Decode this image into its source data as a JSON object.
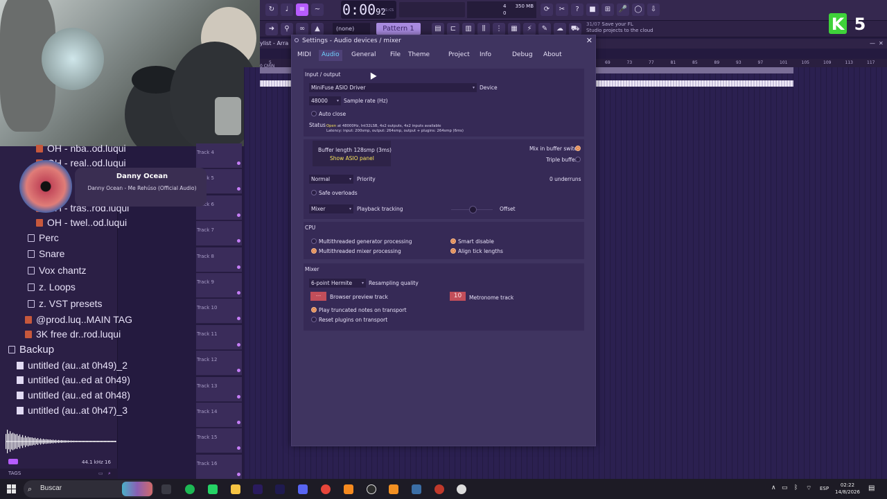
{
  "toolbar": {
    "time_main": "0:00",
    "time_small": "92",
    "time_unit": "M:S:CS",
    "memory": "350 MB",
    "cpu_voices": "4",
    "cpu_zero": "0",
    "pattern": "Pattern 1",
    "none_select": "(none)",
    "hint_counter": "31/07",
    "hint_text_1": "Save your FL",
    "hint_text_2": "Studio projects to the cloud"
  },
  "playlist": {
    "title": "ylist - Arra",
    "ruler_start": "5",
    "ruler_marker": "0 CMIN",
    "ruler_ticks": [
      "69",
      "73",
      "77",
      "81",
      "85",
      "89",
      "93",
      "97",
      "101",
      "105",
      "109",
      "113",
      "117"
    ],
    "tracks": [
      "Track 4",
      "Track 5",
      "Track 6",
      "Track 7",
      "Track 8",
      "Track 9",
      "Track 10",
      "Track 11",
      "Track 12",
      "Track 13",
      "Track 14",
      "Track 15",
      "Track 16"
    ]
  },
  "browser": {
    "items": [
      {
        "label": "OH - nba..od.luqui",
        "type": "oh"
      },
      {
        "label": "OH - real..od.luqui",
        "type": "oh"
      },
      {
        "label": "OH - tras..rod.luqui",
        "type": "oh"
      },
      {
        "label": "OH - twel..od.luqui",
        "type": "oh"
      },
      {
        "label": "Perc",
        "type": "folder"
      },
      {
        "label": "Snare",
        "type": "folder"
      },
      {
        "label": "Vox chantz",
        "type": "folder"
      },
      {
        "label": "z. Loops",
        "type": "folder"
      },
      {
        "label": "z. VST presets",
        "type": "folder"
      },
      {
        "label": "@prod.luq..MAIN TAG",
        "type": "tag"
      },
      {
        "label": "3K free dr..rod.luqui",
        "type": "kit"
      },
      {
        "label": "Backup",
        "type": "backup"
      },
      {
        "label": "untitled (au..at 0h49)_2",
        "type": "file"
      },
      {
        "label": "untitled (au..ed at 0h49)",
        "type": "file"
      },
      {
        "label": "untitled (au..ed at 0h48)",
        "type": "file"
      },
      {
        "label": "untitled (au..at 0h47)_3",
        "type": "file"
      }
    ],
    "sample_rate": "44.1 kHz 16",
    "tags_label": "TAGS"
  },
  "now_playing": {
    "artist": "Danny Ocean",
    "track": "Danny Ocean - Me Rehúso (Official Audio)"
  },
  "dialog": {
    "title": "Settings - Audio devices / mixer",
    "tabs": [
      "MIDI",
      "Audio",
      "General",
      "File",
      "Theme",
      "Project",
      "Info",
      "Debug",
      "About"
    ],
    "active_tab": "Audio",
    "io_title": "Input / output",
    "device_value": "MiniFuse ASIO Driver",
    "device_label": "Device",
    "sample_rate_value": "48000",
    "sample_rate_label": "Sample rate (Hz)",
    "auto_close": "Auto close",
    "status_label": "Status",
    "status_open": "Open",
    "status_line1": " at 48000Hz, Int32LSB, 4x2 outputs, 4x2 inputs available",
    "status_line2": "Latency: input: 200smp, output: 264smp, output + plugins: 264smp (6ms)",
    "buffer_length": "Buffer length 128smp (3ms)",
    "show_asio": "Show ASIO panel",
    "mix_in_buffer": "Mix in buffer switch",
    "triple_buffer": "Triple buffer",
    "priority_value": "Normal",
    "priority_label": "Priority",
    "underruns": "0 underruns",
    "safe_overloads": "Safe overloads",
    "playback_value": "Mixer",
    "playback_label": "Playback tracking",
    "offset_label": "Offset",
    "cpu_title": "CPU",
    "cpu_mt_gen": "Multithreaded generator processing",
    "cpu_mt_mix": "Multithreaded mixer processing",
    "cpu_smart": "Smart disable",
    "cpu_align": "Align tick lengths",
    "mixer_title": "Mixer",
    "resampling_value": "6-point Hermite",
    "resampling_label": "Resampling quality",
    "preview_value": "---",
    "preview_label": "Browser preview track",
    "metronome_value": "10",
    "metronome_label": "Metronome track",
    "play_truncated": "Play truncated notes on transport",
    "reset_plugins": "Reset plugins on transport"
  },
  "logo": {
    "letter": "K",
    "number": "5",
    "colors": {
      "k": "#3fd23a",
      "num": "#ffffff"
    }
  },
  "taskbar": {
    "search_placeholder": "Buscar",
    "language": "ESP",
    "time": "02:22",
    "date": "14/8/2026"
  },
  "colors": {
    "accent": "#b65cff",
    "active_tab": "#6fd2ff",
    "status_open": "#f8e45a",
    "radio_on": "#f3b78c",
    "track_box": "#c24e5a"
  }
}
